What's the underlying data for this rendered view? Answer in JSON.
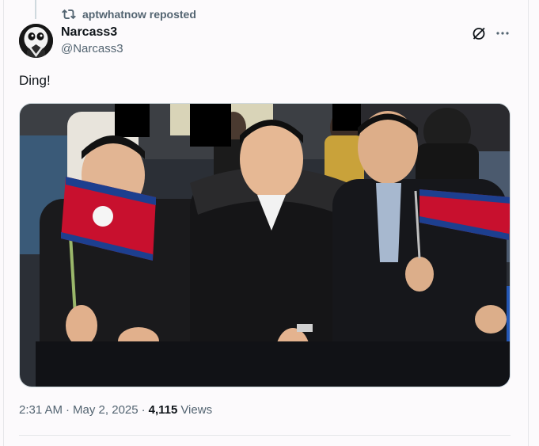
{
  "repost": {
    "icon": "repost-icon",
    "text": "aptwhatnow reposted"
  },
  "author": {
    "display_name": "Narcass3",
    "handle": "@Narcass3",
    "avatar": "avatar-image"
  },
  "actions": {
    "grok_icon": "slash-circle-icon",
    "more_icon": "more-icon"
  },
  "tweet": {
    "text": "Ding!"
  },
  "media": {
    "kind": "photo",
    "accent_colors": [
      "#1f2a44",
      "#c8102e",
      "#1d3f8f"
    ]
  },
  "meta": {
    "time": "2:31 AM",
    "separator1": "·",
    "date": "May 2, 2025",
    "separator2": "·",
    "views_count": "4,115",
    "views_label": "Views"
  }
}
